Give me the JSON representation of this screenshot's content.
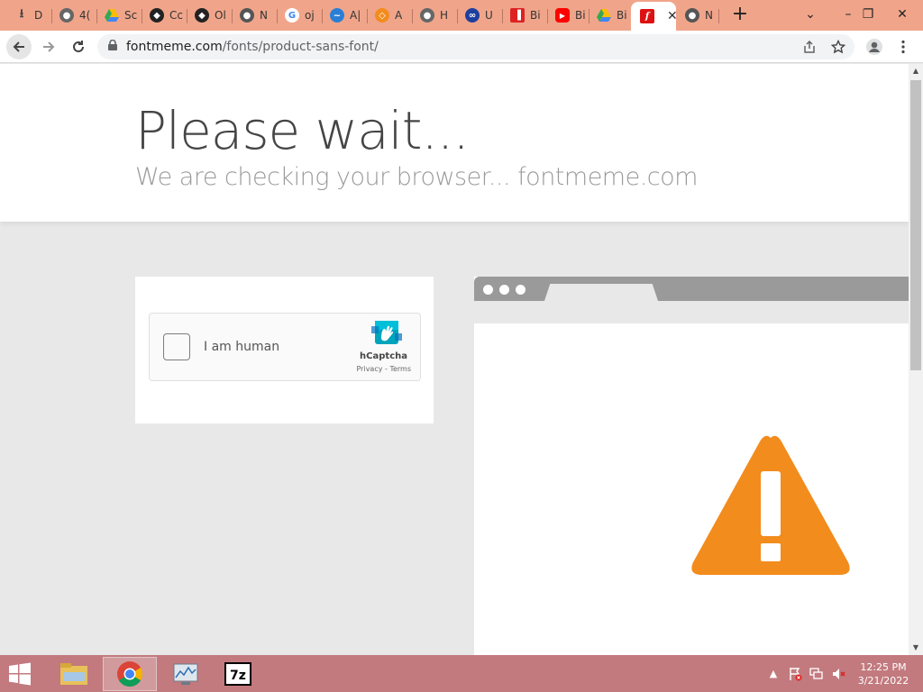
{
  "tabs": [
    {
      "label": "D",
      "icon": "download-icon"
    },
    {
      "label": "4(",
      "icon": "globe-icon"
    },
    {
      "label": "Sc",
      "icon": "google-drive-icon"
    },
    {
      "label": "Cc",
      "icon": "github-icon"
    },
    {
      "label": "Ol",
      "icon": "github-icon"
    },
    {
      "label": "N",
      "icon": "chrome-icon"
    },
    {
      "label": "oj",
      "icon": "google-icon"
    },
    {
      "label": "A|",
      "icon": "app-icon"
    },
    {
      "label": "A",
      "icon": "diamond-icon"
    },
    {
      "label": "H",
      "icon": "globe-icon"
    },
    {
      "label": "U",
      "icon": "link-icon"
    },
    {
      "label": "Bi",
      "icon": "bookmark-icon"
    },
    {
      "label": "Bi",
      "icon": "youtube-icon"
    },
    {
      "label": "Bi",
      "icon": "google-drive-icon"
    },
    {
      "label": "",
      "icon": "fontmeme-icon",
      "active": true
    },
    {
      "label": "N",
      "icon": "chrome-icon"
    }
  ],
  "address": {
    "host": "fontmeme.com",
    "path": "/fonts/product-sans-font/"
  },
  "page": {
    "title": "Please wait...",
    "subtitle": "We are checking your browser... fontmeme.com",
    "captcha": {
      "label": "I am human",
      "brand": "hCaptcha",
      "links": "Privacy - Terms"
    }
  },
  "taskbar": {
    "time": "12:25 PM",
    "date": "3/21/2022",
    "items": [
      "file-explorer-icon",
      "chrome-icon",
      "resource-monitor-icon",
      "7zip-icon"
    ]
  },
  "colors": {
    "tabstrip": "#f0a58a",
    "warning": "#f28c1d",
    "taskbar": "#c27a7e",
    "hcaptcha_teal": "#0074bf"
  }
}
